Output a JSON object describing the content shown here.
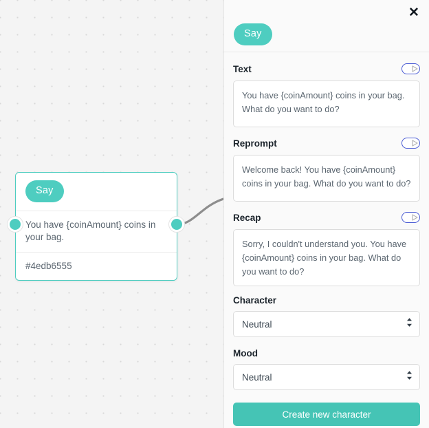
{
  "theme": {
    "accent_teal": "#4ecdc0",
    "button_teal": "#45c4b5",
    "toggle_border": "#4a5bd4",
    "canvas_bg": "#f4f4f4",
    "panel_bg": "#fafafa"
  },
  "canvas": {
    "node": {
      "type_label": "Say",
      "body_text": "You have {coinAmount} coins in your bag.",
      "id_label": "#4edb6555"
    }
  },
  "panel": {
    "close_label": "✕",
    "node_type_pill": "Say",
    "fields": [
      {
        "label": "Text",
        "value": "You have {coinAmount} coins in your bag. What do you want to do?",
        "toggle_icon": "play-icon"
      },
      {
        "label": "Reprompt",
        "value": "Welcome back! You have {coinAmount} coins in your bag. What do you want to do?",
        "toggle_icon": "play-icon"
      },
      {
        "label": "Recap",
        "value": "Sorry, I couldn't understand you. You have {coinAmount} coins in your bag. What do you want to do?",
        "toggle_icon": "play-icon"
      }
    ],
    "character": {
      "label": "Character",
      "selected": "Neutral",
      "options": [
        "Neutral"
      ]
    },
    "mood": {
      "label": "Mood",
      "selected": "Neutral",
      "options": [
        "Neutral"
      ]
    },
    "create_button_label": "Create new character"
  }
}
